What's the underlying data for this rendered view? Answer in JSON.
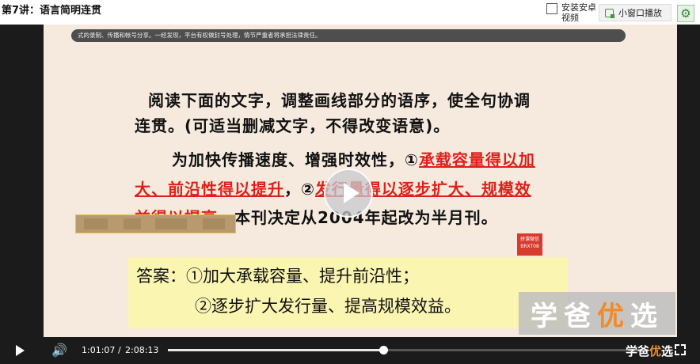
{
  "header": {
    "title": "第7讲：语言简明连贯",
    "install_label": "安装安卓视频",
    "mini_window_label": "小窗口播放",
    "icons": {
      "settings": "gear-icon",
      "mini_window": "picture-in-picture-icon"
    }
  },
  "slide": {
    "banner": "式的录制、传播和帐号分享。一经发现，平台有权做封号处理，情节严重者将承担法律责任。",
    "question": [
      "阅读下面的文字，调整画线部分的语序，使全句协调",
      "连贯。(可适当删减文字，不得改变语意)。"
    ],
    "sentence": {
      "l1_black": "为加快传播速度、增强时效性，①",
      "l1_red": "承载容量得以加",
      "l2_red_a": "大、前沿性得以提升",
      "l2_black": "，②",
      "l2_red_b": "发行量得以逐步扩大、规模效",
      "l3_red": "益得以提高",
      "l3_black": "，本刊决定从2004年起改为半月刊。"
    },
    "seal_text": "拼课微信 BRXT08",
    "answer": {
      "line1": "答案：①加大承载容量、提升前沿性；",
      "line2": "②逐步扩大发行量、提高规模效益。"
    },
    "watermark_main": "学爸",
    "watermark_accent": "优",
    "watermark_tail": "选"
  },
  "player": {
    "current_time": "1:01:07",
    "time_separator": "/",
    "total_time": "2:08:13",
    "progress": 0.457,
    "watermark_main": "学爸",
    "watermark_accent": "优",
    "watermark_tail": "选",
    "icons": {
      "play": "play-icon",
      "volume": "volume-icon",
      "fullscreen": "fullscreen-icon"
    }
  }
}
